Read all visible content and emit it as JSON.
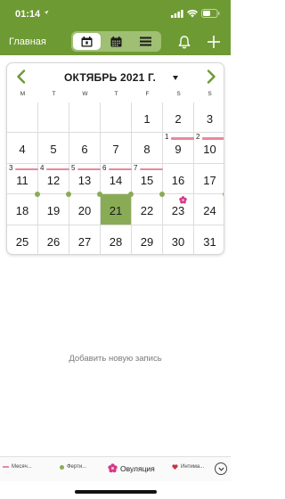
{
  "status": {
    "time": "01:14"
  },
  "nav": {
    "title": "Главная"
  },
  "calendar": {
    "month_title": "ОКТЯБРЬ 2021 Г.",
    "weekdays": [
      "M",
      "T",
      "W",
      "T",
      "F",
      "S",
      "S"
    ],
    "selected_day": "21",
    "weeks": [
      [
        {
          "n": ""
        },
        {
          "n": ""
        },
        {
          "n": ""
        },
        {
          "n": ""
        },
        {
          "n": "1"
        },
        {
          "n": "2"
        },
        {
          "n": "3"
        }
      ],
      [
        {
          "n": "4"
        },
        {
          "n": "5"
        },
        {
          "n": "6"
        },
        {
          "n": "7"
        },
        {
          "n": "8"
        },
        {
          "n": "9",
          "period": "1"
        },
        {
          "n": "10",
          "period": "2"
        }
      ],
      [
        {
          "n": "11",
          "period": "3"
        },
        {
          "n": "12",
          "period": "4"
        },
        {
          "n": "13",
          "period": "5"
        },
        {
          "n": "14",
          "period": "6"
        },
        {
          "n": "15",
          "period": "7"
        },
        {
          "n": "16"
        },
        {
          "n": "17"
        }
      ],
      [
        {
          "n": "18",
          "fertile": true
        },
        {
          "n": "19",
          "fertile": true
        },
        {
          "n": "20",
          "fertile": true
        },
        {
          "n": "21",
          "fertile": true,
          "selected": true
        },
        {
          "n": "22",
          "fertile": true
        },
        {
          "n": "23",
          "ovulation": true
        },
        {
          "n": "24",
          "fertile": true
        }
      ],
      [
        {
          "n": "25"
        },
        {
          "n": "26"
        },
        {
          "n": "27"
        },
        {
          "n": "28"
        },
        {
          "n": "29"
        },
        {
          "n": "30"
        },
        {
          "n": "31"
        }
      ]
    ]
  },
  "main": {
    "add_entry": "Добавить новую запись"
  },
  "legend": {
    "menstruation": "Месяч...",
    "fertile": "Ферти...",
    "ovulation": "Овуляция",
    "intimacy": "Интима..."
  },
  "colors": {
    "brand_green": "#6e9a33",
    "selected_green": "#8aab55",
    "period_pink": "#e8899d",
    "ovulation_magenta": "#d63a86",
    "heart_red": "#c8324a"
  },
  "icons": {
    "status": [
      "location-arrow-icon",
      "signal-icon",
      "wifi-icon",
      "battery-icon"
    ],
    "nav": [
      "day-view-icon",
      "month-view-icon",
      "list-view-icon",
      "bell-icon",
      "plus-icon"
    ],
    "calendar": [
      "chevron-left-icon",
      "chevron-right-icon",
      "caret-down-icon",
      "flower-icon"
    ],
    "legend": [
      "period-line-icon",
      "fertile-dot-icon",
      "flower-icon",
      "heart-icon",
      "chevron-down-icon"
    ]
  }
}
